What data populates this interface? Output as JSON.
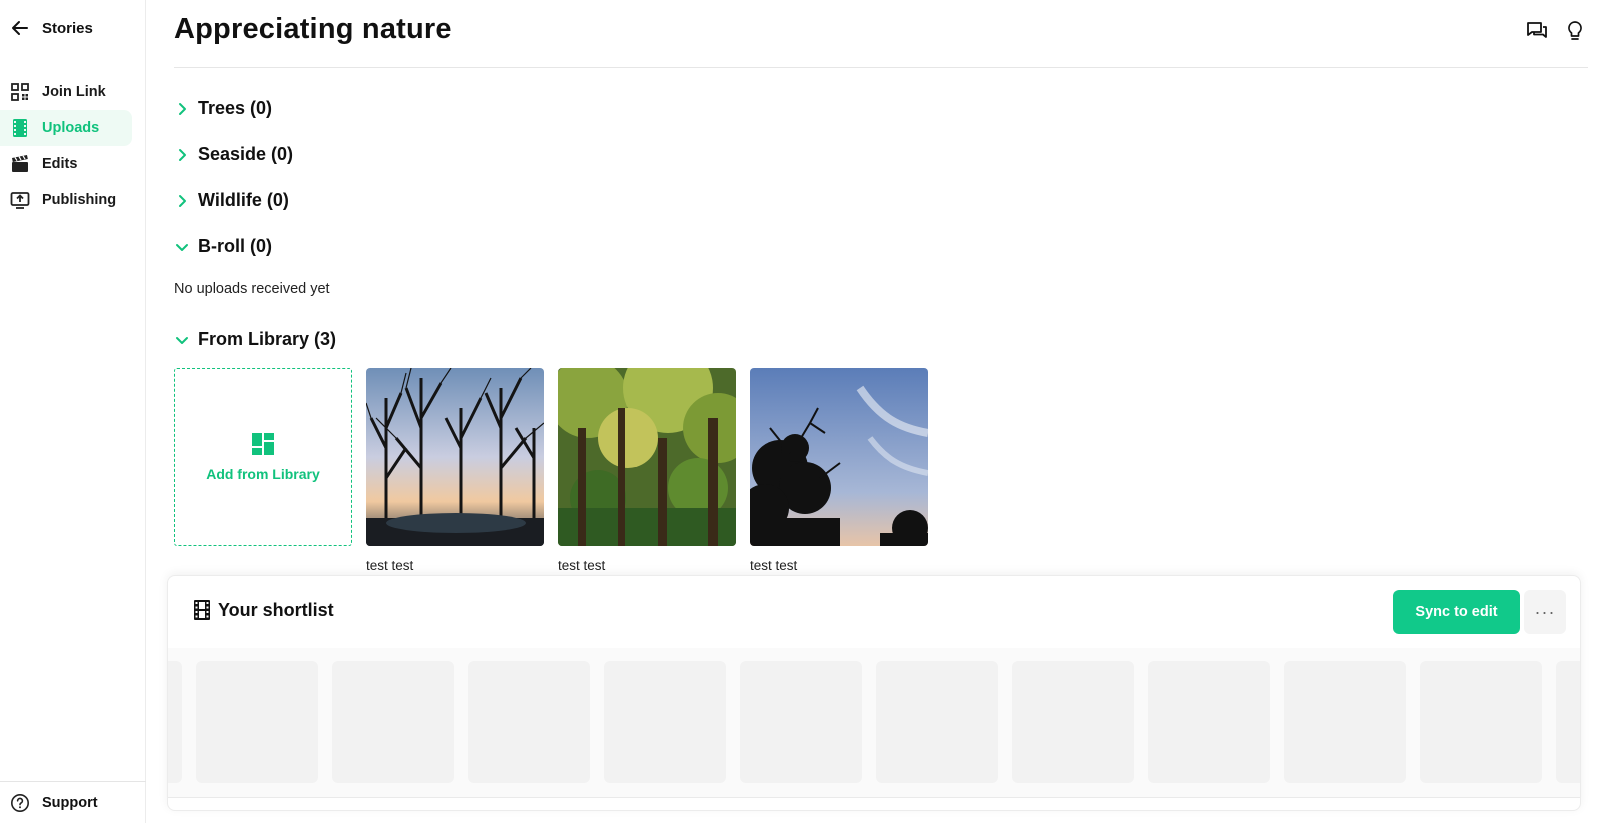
{
  "sidebar": {
    "back_label": "Stories",
    "items": [
      {
        "label": "Join Link",
        "icon": "qr-code-icon",
        "active": false
      },
      {
        "label": "Uploads",
        "icon": "film-strip-icon",
        "active": true
      },
      {
        "label": "Edits",
        "icon": "clapperboard-icon",
        "active": false
      },
      {
        "label": "Publishing",
        "icon": "monitor-upload-icon",
        "active": false
      }
    ],
    "support_label": "Support"
  },
  "header": {
    "title": "Appreciating nature",
    "icons": [
      "chat-icon",
      "lightbulb-icon"
    ]
  },
  "sections": [
    {
      "label": "Trees (0)",
      "expanded": false
    },
    {
      "label": "Seaside (0)",
      "expanded": false
    },
    {
      "label": "Wildlife (0)",
      "expanded": false
    },
    {
      "label": "B-roll (0)",
      "expanded": true,
      "empty_text": "No uploads received yet"
    },
    {
      "label": "From Library (3)",
      "expanded": true
    }
  ],
  "library": {
    "add_label": "Add from Library",
    "items": [
      {
        "caption": "test test"
      },
      {
        "caption": "test test"
      },
      {
        "caption": "test test"
      }
    ]
  },
  "shortlist": {
    "title": "Your shortlist",
    "sync_label": "Sync to edit",
    "more_label": "···"
  },
  "colors": {
    "accent": "#11c27d",
    "accent_bg": "#eefaf4",
    "button": "#11c98a"
  }
}
